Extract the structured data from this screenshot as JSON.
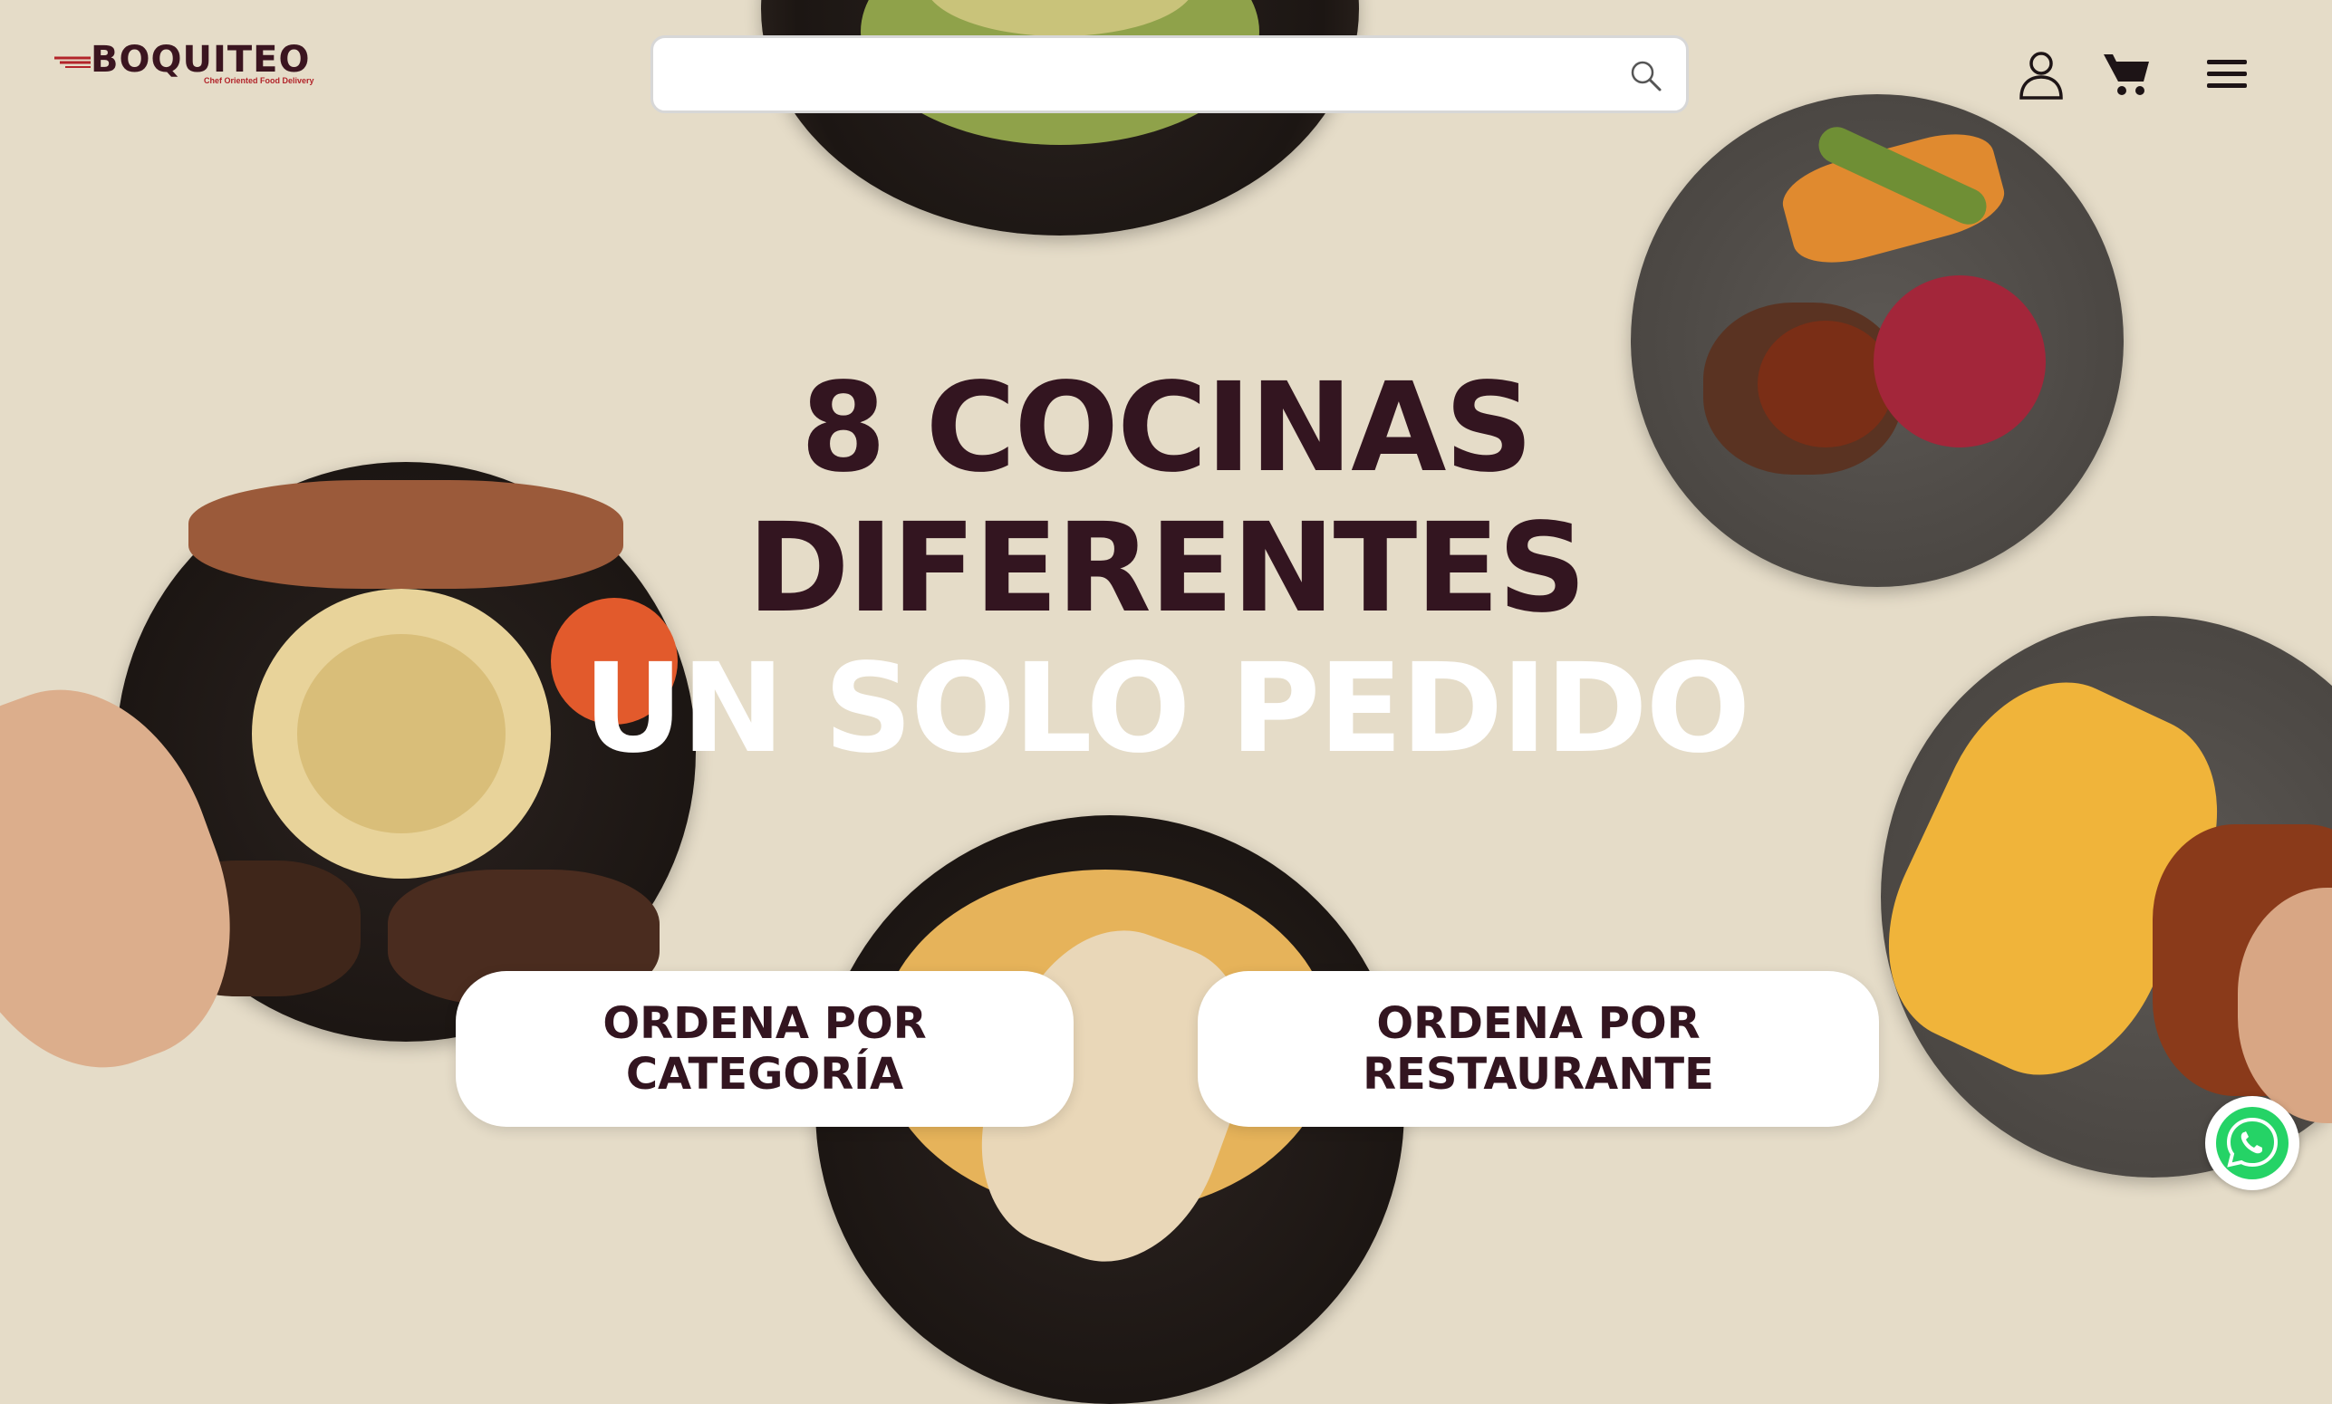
{
  "brand": {
    "name": "BOQUITEO",
    "tagline": "Chef Oriented Food Delivery",
    "primary_color": "#331520",
    "accent_color": "#b2242a",
    "background_color": "#e5dcc8"
  },
  "search": {
    "value": "",
    "placeholder": "",
    "icon": "search-icon"
  },
  "header_icons": [
    "user-icon",
    "cart-icon",
    "menu-icon"
  ],
  "hero": {
    "line1": "8 COCINAS",
    "line2": "DIFERENTES",
    "line3": "UN SOLO PEDIDO"
  },
  "cta": {
    "by_category": "ORDENA POR CATEGORÍA",
    "by_restaurant": "ORDENA POR RESTAURANTE"
  },
  "whatsapp": {
    "icon": "whatsapp-icon",
    "color": "#25d366"
  }
}
